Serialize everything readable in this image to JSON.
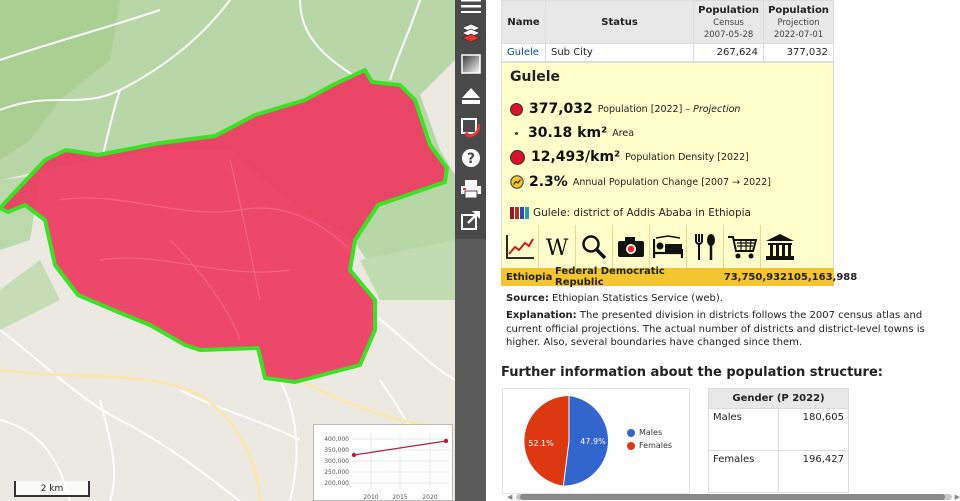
{
  "map": {
    "scale_label": "2 km",
    "mini_chart": {
      "y_ticks": [
        "400,000",
        "350,000",
        "300,000",
        "250,000",
        "200,000"
      ],
      "x_ticks": [
        "2010",
        "2015",
        "2020"
      ]
    }
  },
  "toolbar": {
    "buttons": [
      "menu-icon",
      "layers-icon",
      "gradient-icon",
      "eject-icon",
      "refresh-icon",
      "help-icon",
      "print-icon",
      "share-icon"
    ]
  },
  "pop_table": {
    "headers": {
      "name": "Name",
      "status": "Status",
      "pop1": "Population",
      "pop1_sub1": "Census",
      "pop1_sub2": "2007-05-28",
      "pop2": "Population",
      "pop2_sub1": "Projection",
      "pop2_sub2": "2022-07-01"
    },
    "row": {
      "name": "Gulele",
      "status": "Sub City",
      "pop2007": "267,624",
      "pop2022": "377,032"
    }
  },
  "infobox": {
    "title": "Gulele",
    "population": {
      "value": "377,032",
      "label": "Population [2022]",
      "note": "– Projection"
    },
    "area": {
      "value": "30.18 km²",
      "label": "Area"
    },
    "density": {
      "value": "12,493/km²",
      "label": "Population Density [2022]"
    },
    "change": {
      "value": "2.3%",
      "label": "Annual Population Change [2007 → 2022]"
    },
    "description": "Gulele: district of Addis Ababa in Ethiopia",
    "icons": [
      "line-chart-icon",
      "wikipedia-icon",
      "search-icon",
      "camera-icon",
      "hotel-icon",
      "restaurant-icon",
      "shopping-cart-icon",
      "museum-icon"
    ]
  },
  "country_row": {
    "name": "Ethiopia",
    "status": "Federal Democratic Republic",
    "pop2007": "73,750,932",
    "pop2022": "105,163,988"
  },
  "source": {
    "label": "Source:",
    "text": "Ethiopian Statistics Service (web)."
  },
  "explanation": {
    "label": "Explanation:",
    "text": "The presented division in districts follows the 2007 census atlas and current official projections. The actual number of districts and district-level towns is higher. Also, several boundaries have changed since them."
  },
  "further_title": "Further information about the population structure:",
  "gender_chart": {
    "legend": [
      "Males",
      "Females"
    ],
    "labels": [
      "47.9%",
      "52.1%"
    ],
    "colors": {
      "males": "#3366cc",
      "females": "#dc3912"
    }
  },
  "gender_table": {
    "header": "Gender (P 2022)",
    "rows": [
      {
        "label": "Males",
        "value": "180,605"
      },
      {
        "label": "Females",
        "value": "196,427"
      }
    ]
  },
  "colors": {
    "region_fill": "#ed3a5f",
    "region_border": "#3de024",
    "infobox_bg": "#ffffcc",
    "country_bg": "#f5c431"
  }
}
